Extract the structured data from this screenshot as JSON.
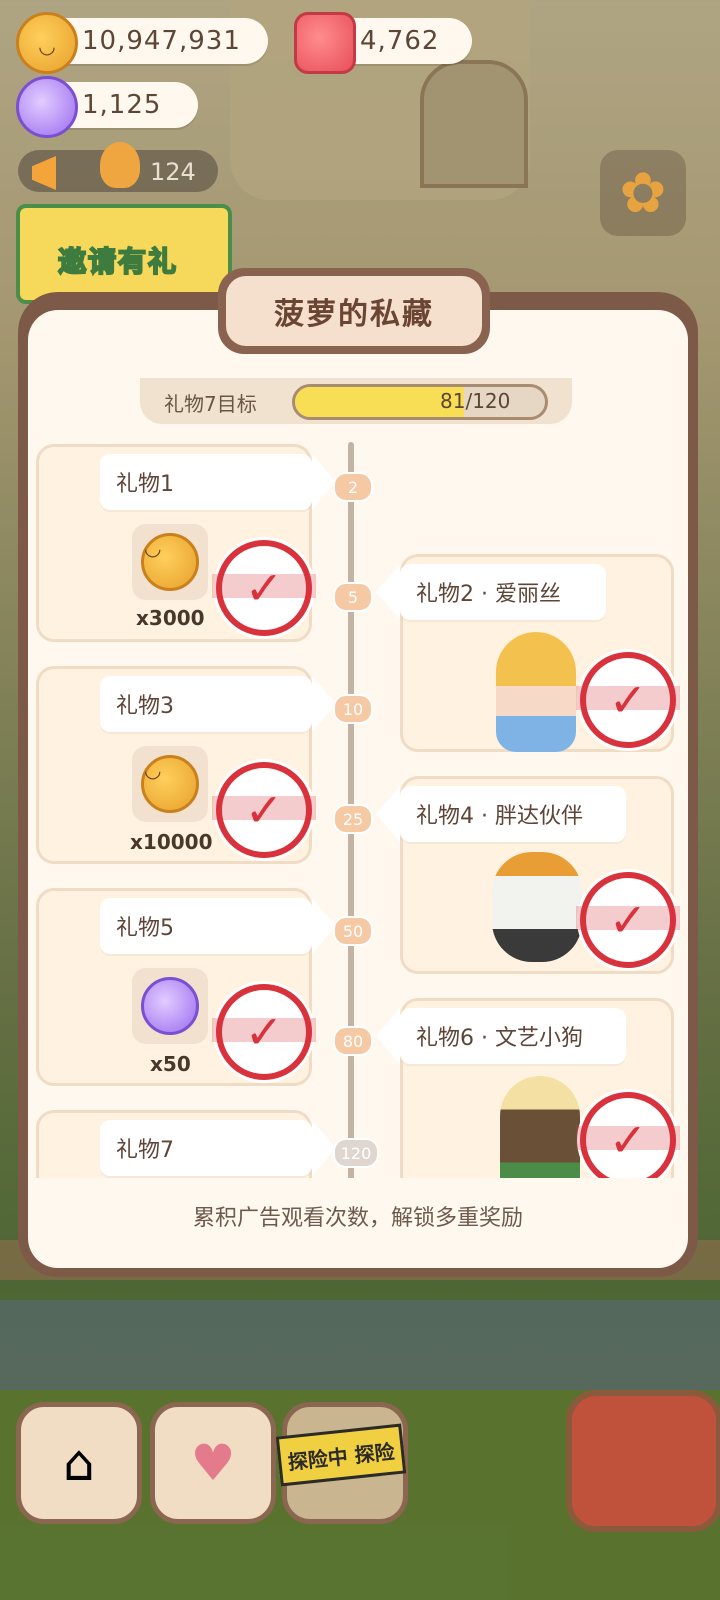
{
  "resources": {
    "cookies": "10,947,931",
    "jelly": "4,762",
    "candy": "1,125"
  },
  "broadcast": {
    "count": "124"
  },
  "invite": {
    "label": "邀请有礼"
  },
  "modal": {
    "title": "菠萝的私藏",
    "goal_label": "礼物7目标",
    "progress_text": "81/120",
    "progress": {
      "current": 81,
      "total": 120
    },
    "footer": "累积广告观看次数，解锁多重奖励",
    "gifts": [
      {
        "label": "礼物1",
        "node": "2",
        "qty": "x3000",
        "reward": "cookie-icon",
        "claimed": true
      },
      {
        "label": "礼物2 · 爱丽丝",
        "node": "5",
        "reward": "alice-character",
        "claimed": true
      },
      {
        "label": "礼物3",
        "node": "10",
        "qty": "x10000",
        "reward": "cookie-icon",
        "claimed": true
      },
      {
        "label": "礼物4 · 胖达伙伴",
        "node": "25",
        "reward": "panda-character",
        "claimed": true
      },
      {
        "label": "礼物5",
        "node": "50",
        "qty": "x50",
        "reward": "candy-icon",
        "claimed": true
      },
      {
        "label": "礼物6 · 文艺小狗",
        "node": "80",
        "reward": "dog-character",
        "claimed": true
      },
      {
        "label": "礼物7",
        "node": "120",
        "claimed": false
      }
    ]
  },
  "bottom_nav": {
    "explore_badge": "探险中 探险"
  },
  "colors": {
    "stamp_red": "#d8333c",
    "progress_yellow": "#f7de55",
    "modal_brown": "#7d5a47"
  }
}
